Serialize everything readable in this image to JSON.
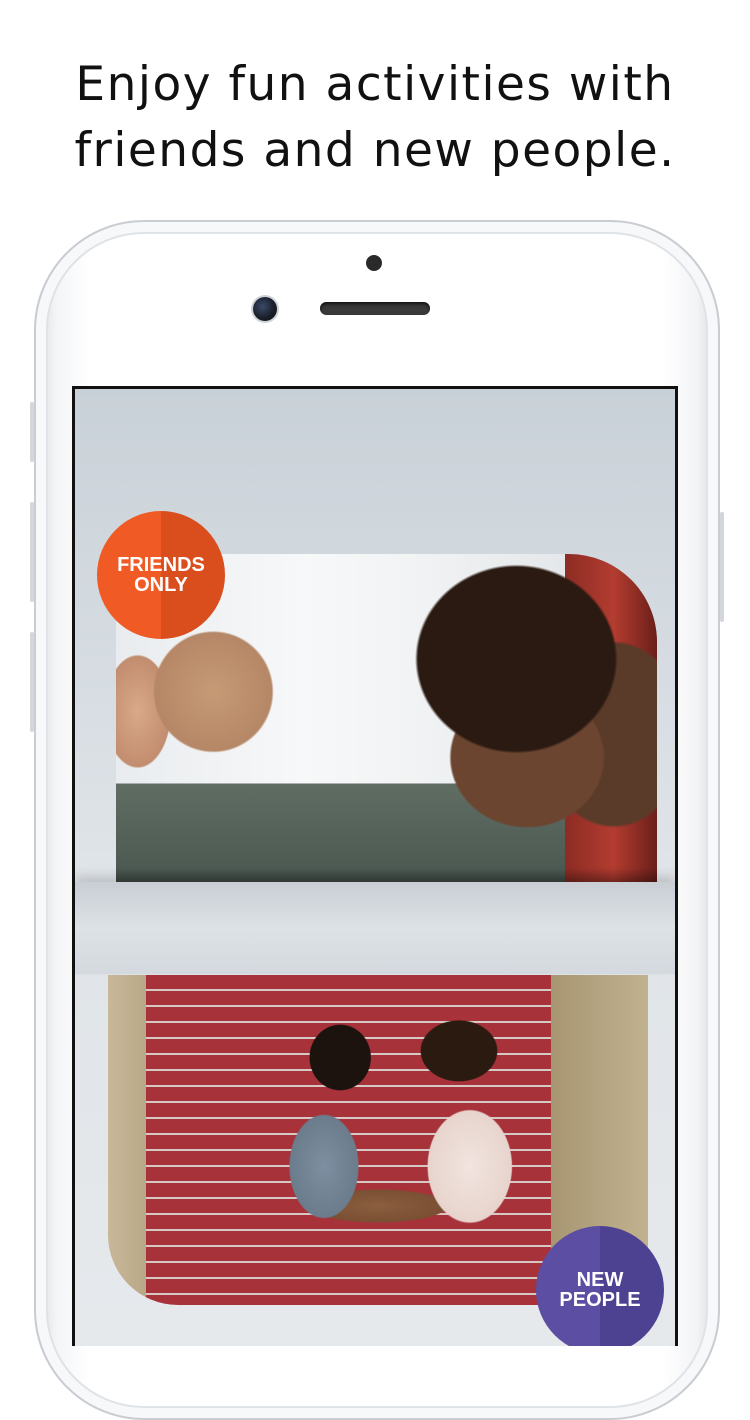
{
  "headline": {
    "line1": "Enjoy fun activities with",
    "line2": "friends and new people."
  },
  "badges": {
    "friends_only": {
      "line1": "FRIENDS",
      "line2": "ONLY",
      "color": "#f05a24"
    },
    "new_people": {
      "line1": "NEW",
      "line2": "PEOPLE",
      "color": "#5b4ea3"
    }
  },
  "images": {
    "top": {
      "icon": "friends-photo"
    },
    "bottom": {
      "icon": "new-people-photo"
    }
  }
}
